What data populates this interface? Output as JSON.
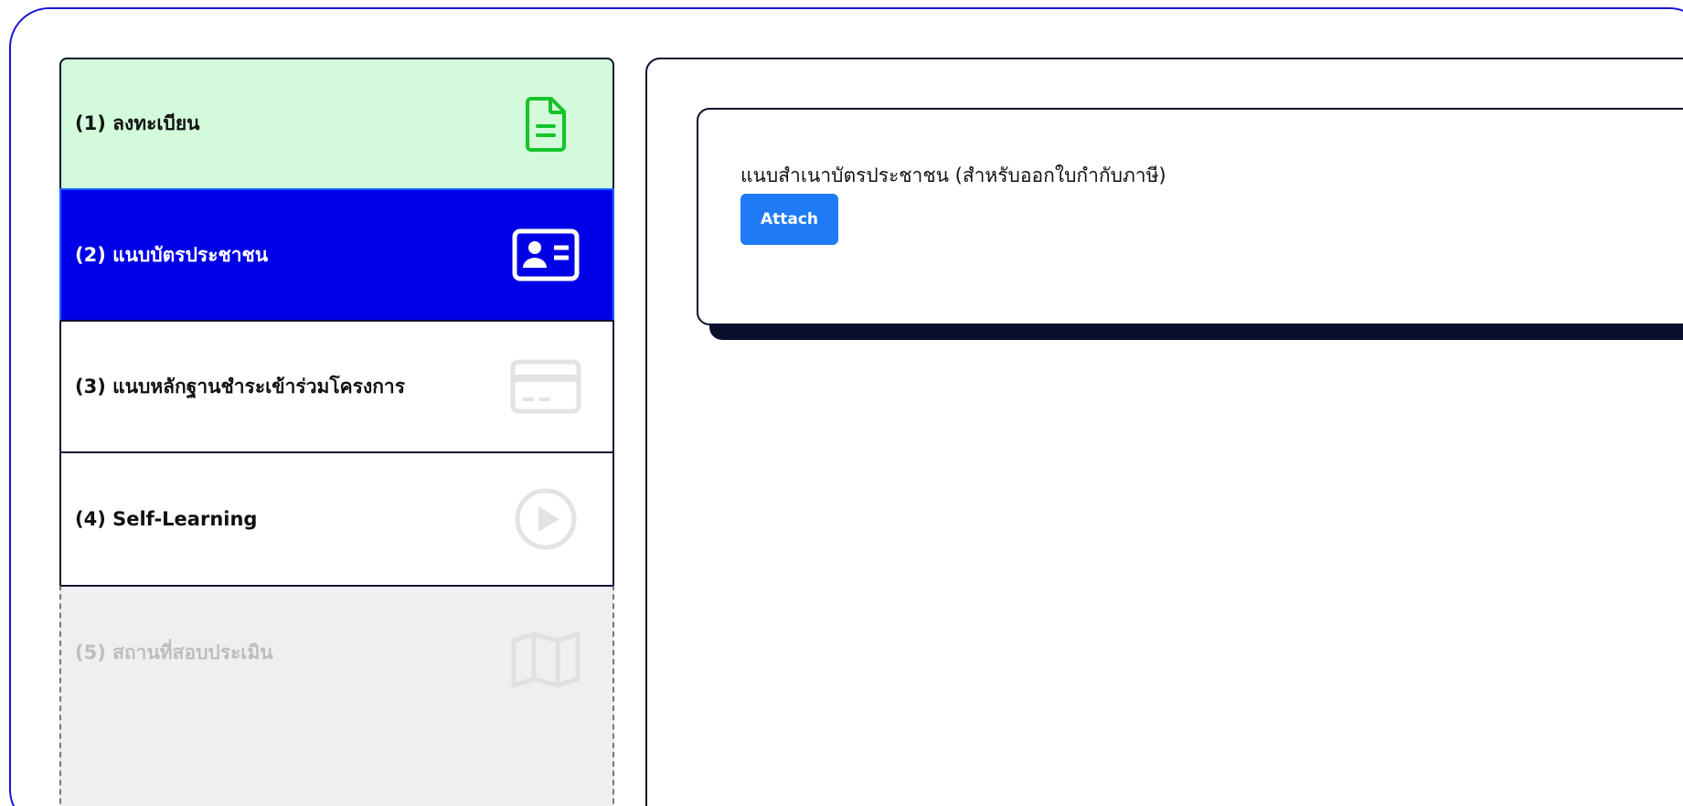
{
  "steps": [
    {
      "label": "(1) ลงทะเบียน",
      "icon": "document-icon",
      "state": "completed",
      "color": "#16c42a"
    },
    {
      "label": "(2) แนบบัตรประชาชน",
      "icon": "id-card-icon",
      "state": "active",
      "color": "#ffffff"
    },
    {
      "label": "(3) แนบหลักฐานชำระเข้าร่วมโครงการ",
      "icon": "credit-card-icon",
      "state": "pending",
      "color": "#e3e3e3"
    },
    {
      "label": "(4) Self-Learning",
      "icon": "play-circle-icon",
      "state": "pending",
      "color": "#e3e3e3"
    },
    {
      "label": "(5) สถานที่สอบประเมิน",
      "icon": "map-icon",
      "state": "disabled",
      "color": "#e0e0e0"
    }
  ],
  "card": {
    "title": "แนบสำเนาบัตรประชาชน (สำหรับออกใบกำกับภาษี)",
    "attach_label": "Attach"
  },
  "colors": {
    "frame": "#1a14d6",
    "active_step": "#0000e6",
    "completed_step": "#d2fadb",
    "button": "#1e7bf5"
  }
}
